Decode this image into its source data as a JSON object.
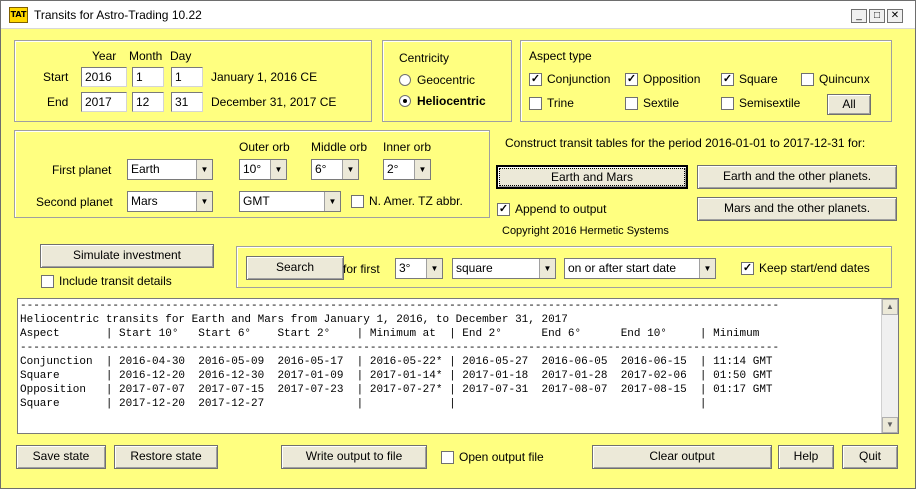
{
  "window": {
    "icon_text": "TAT",
    "title": "Transits for Astro-Trading 10.22",
    "minimize": "_",
    "maximize": "□",
    "close": "✕"
  },
  "dates": {
    "col_year": "Year",
    "col_month": "Month",
    "col_day": "Day",
    "start_label": "Start",
    "end_label": "End",
    "start_year": "2016",
    "start_month": "1",
    "start_day": "1",
    "start_text": "January 1, 2016 CE",
    "end_year": "2017",
    "end_month": "12",
    "end_day": "31",
    "end_text": "December 31, 2017 CE"
  },
  "centricity": {
    "title": "Centricity",
    "geocentric": "Geocentric",
    "heliocentric": "Heliocentric",
    "selected": "heliocentric"
  },
  "aspect_type": {
    "title": "Aspect type",
    "conjunction": "Conjunction",
    "opposition": "Opposition",
    "square": "Square",
    "quincunx": "Quincunx",
    "trine": "Trine",
    "sextile": "Sextile",
    "semisextile": "Semisextile",
    "all_button": "All",
    "checked_mark": "✓"
  },
  "planets": {
    "first_label": "First planet",
    "first_value": "Earth",
    "second_label": "Second planet",
    "second_value": "Mars",
    "outer_orb_label": "Outer orb",
    "outer_orb": "10°",
    "middle_orb_label": "Middle orb",
    "middle_orb": "6°",
    "inner_orb_label": "Inner orb",
    "inner_orb": "2°",
    "timezone": "GMT",
    "tz_abbr_label": "N. Amer. TZ abbr."
  },
  "construct": {
    "text": "Construct transit tables for the period 2016-01-01 to 2017-12-31 for:",
    "earth_mars": "Earth and Mars",
    "earth_others": "Earth and the other planets.",
    "mars_others": "Mars and the other planets.",
    "append_label": "Append to output",
    "copyright": "Copyright 2016 Hermetic Systems"
  },
  "simulate": {
    "button": "Simulate investment",
    "details_label": "Include transit details"
  },
  "search": {
    "button": "Search",
    "for_first": "for first",
    "orb": "3°",
    "aspect": "square",
    "when": "on or after start date",
    "keep_dates_label": "Keep start/end dates"
  },
  "output": {
    "lines": [
      "-------------------------------------------------------------------------------------------------------------------",
      "Heliocentric transits for Earth and Mars from January 1, 2016, to December 31, 2017",
      "Aspect       | Start 10°   Start 6°    Start 2°    | Minimum at  | End 2°      End 6°      End 10°     | Minimum",
      "-------------------------------------------------------------------------------------------------------------------",
      "Conjunction  | 2016-04-30  2016-05-09  2016-05-17  | 2016-05-22* | 2016-05-27  2016-06-05  2016-06-15  | 11:14 GMT",
      "Square       | 2016-12-20  2016-12-30  2017-01-09  | 2017-01-14* | 2017-01-18  2017-01-28  2017-02-06  | 01:50 GMT",
      "Opposition   | 2017-07-07  2017-07-15  2017-07-23  | 2017-07-27* | 2017-07-31  2017-08-07  2017-08-15  | 01:17 GMT",
      "Square       | 2017-12-20  2017-12-27              |             |                                     |"
    ]
  },
  "footer": {
    "save_state": "Save state",
    "restore_state": "Restore state",
    "write_output": "Write output to file",
    "open_output_label": "Open output file",
    "clear_output": "Clear output",
    "help": "Help",
    "quit": "Quit"
  }
}
